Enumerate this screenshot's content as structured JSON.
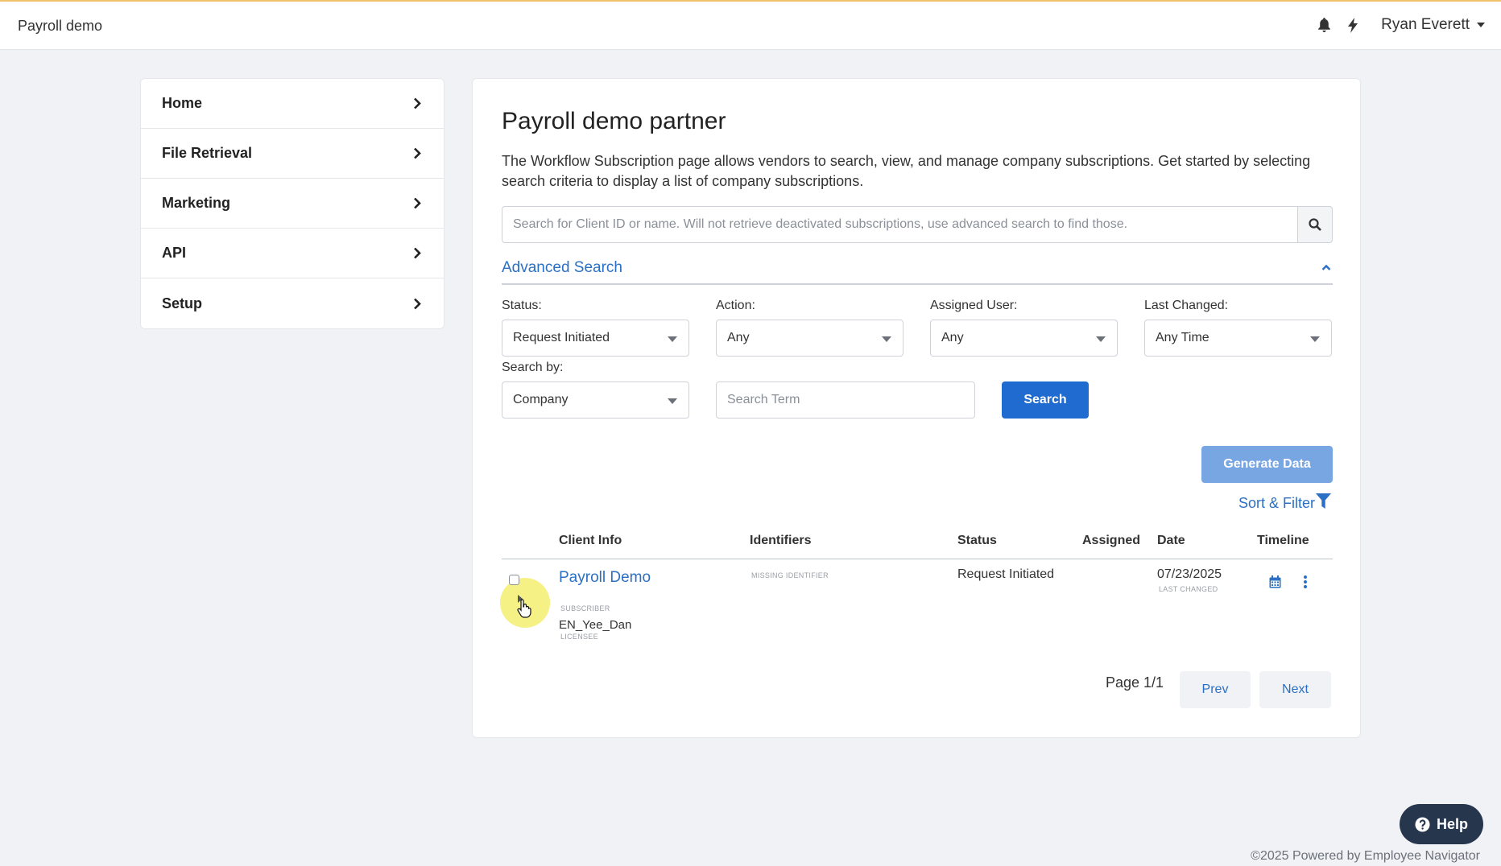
{
  "topbar": {
    "brand": "Payroll demo",
    "user_name": "Ryan Everett",
    "icons": [
      "bell-icon",
      "bolt-icon"
    ]
  },
  "sidebar": {
    "items": [
      {
        "label": "Home"
      },
      {
        "label": "File Retrieval"
      },
      {
        "label": "Marketing"
      },
      {
        "label": "API"
      },
      {
        "label": "Setup"
      }
    ]
  },
  "main": {
    "title": "Payroll demo partner",
    "description": "The Workflow Subscription page allows vendors to search, view, and manage company subscriptions. Get started by selecting search criteria to display a list of company subscriptions.",
    "search_placeholder": "Search for Client ID or name. Will not retrieve deactivated subscriptions, use advanced search to find those.",
    "advanced_search_label": "Advanced Search",
    "filters": {
      "status_label": "Status:",
      "status_value": "Request Initiated",
      "action_label": "Action:",
      "action_value": "Any",
      "assigned_label": "Assigned User:",
      "assigned_value": "Any",
      "changed_label": "Last Changed:",
      "changed_value": "Any Time",
      "searchby_label": "Search by:",
      "searchby_value": "Company",
      "term_placeholder": "Search Term",
      "search_button": "Search"
    },
    "generate_button": "Generate Data",
    "sort_filter_label": "Sort & Filter",
    "table": {
      "headers": {
        "client": "Client Info",
        "identifiers": "Identifiers",
        "status": "Status",
        "assigned": "Assigned",
        "date": "Date",
        "timeline": "Timeline"
      },
      "rows": [
        {
          "client_name": "Payroll Demo",
          "subscriber_caption": "SUBSCRIBER",
          "licensee": "EN_Yee_Dan",
          "licensee_caption": "LICENSEE",
          "identifier": "MISSING IDENTIFIER",
          "status": "Request Initiated",
          "assigned": "",
          "date": "07/23/2025",
          "date_caption": "LAST CHANGED"
        }
      ]
    },
    "pagination": {
      "page_info": "Page 1/1",
      "prev": "Prev",
      "next": "Next"
    }
  },
  "help_label": "Help",
  "footer": "©2025 Powered by Employee Navigator",
  "colors": {
    "accent": "#1f6bd0",
    "link": "#2b70c4",
    "help_bg": "#25364d"
  }
}
